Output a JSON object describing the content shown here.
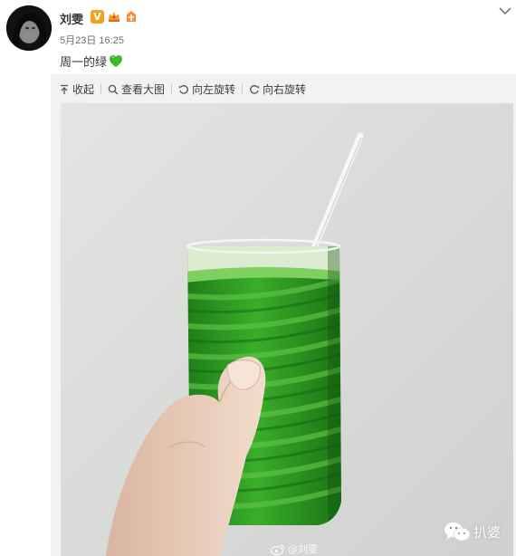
{
  "post": {
    "user_name": "刘雯",
    "verified_badge": "V",
    "time": "5月23日 16:25",
    "text": "周一的绿",
    "text_emoji": "green-heart-icon"
  },
  "toolbar": {
    "items": [
      {
        "label": "收起",
        "icon": "collapse-icon"
      },
      {
        "label": "查看大图",
        "icon": "magnifier-icon"
      },
      {
        "label": "向左旋转",
        "icon": "rotate-left-icon"
      },
      {
        "label": "向右旋转",
        "icon": "rotate-right-icon"
      }
    ]
  },
  "image": {
    "subject": "hand holding green drink glass with straw",
    "watermark": "@刘雯"
  },
  "overlay": {
    "account_name": "扒婆"
  },
  "colors": {
    "drink_green": "#2f9d1f",
    "badge_orange": "#f2a21e",
    "heart_green": "#3cb82b",
    "background": "#f2f2f5"
  }
}
